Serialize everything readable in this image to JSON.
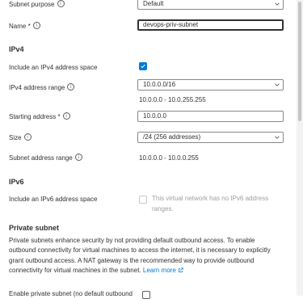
{
  "subnet_purpose": {
    "label": "Subnet purpose",
    "value": "Default"
  },
  "name": {
    "label": "Name *",
    "value": "devops-priv-subnet"
  },
  "ipv4": {
    "heading": "IPv4",
    "include_label": "Include an IPv4 address space",
    "include_checked": true,
    "address_range_label": "IPv4 address range",
    "address_range_value": "10.0.0.0/16",
    "address_range_detail": "10.0.0.0 - 10.0.255.255",
    "starting_address_label": "Starting address *",
    "starting_address_value": "10.0.0.0",
    "size_label": "Size",
    "size_value": "/24 (256 addresses)",
    "subnet_range_label": "Subnet address range",
    "subnet_range_value": "10.0.0.0 - 10.0.0.255"
  },
  "ipv6": {
    "heading": "IPv6",
    "include_label": "Include an IPv6 address space",
    "include_checked": false,
    "disabled_note_line1": "This virtual network has no IPv6 address",
    "disabled_note_line2": "ranges."
  },
  "private_subnet": {
    "heading": "Private subnet",
    "description_line1": "Private subnets enhance security by not providing default outbound access. To enable",
    "description_line2": "outbound connectivity for virtual machines to access the internet, it is necessary to explicitly",
    "description_line3": "grant outbound access. A NAT gateway is the recommended way to provide outbound",
    "description_line4": "connectivity for virtual machines in the subnet.",
    "learn_more": "Learn more",
    "enable_label": "Enable private subnet (no default outbound"
  },
  "icons": {
    "info": "info-icon",
    "chevron": "chevron-down-icon",
    "check": "checkmark-icon",
    "external": "external-link-icon"
  },
  "colors": {
    "accent": "#0078d4",
    "text": "#323130",
    "border": "#8a8886"
  }
}
